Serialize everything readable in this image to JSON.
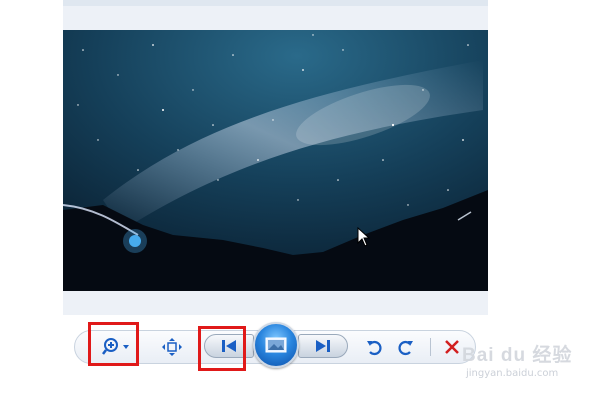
{
  "image_viewer": {
    "photo": {
      "subject": "night-sky-milky-way"
    },
    "toolbar": {
      "buttons": {
        "zoom": "zoom-icon",
        "fit": "fit-window-icon",
        "previous": "previous-icon",
        "slideshow": "slideshow-icon",
        "next": "next-icon",
        "rotate_ccw": "rotate-counterclockwise-icon",
        "rotate_cw": "rotate-clockwise-icon",
        "delete": "delete-icon"
      },
      "accent_color": "#1a5fc4",
      "delete_color": "#d21f1f"
    }
  },
  "annotations": {
    "highlight_color": "#e01919"
  },
  "watermark": {
    "main": "Bai du 经验",
    "sub": "jingyan.baidu.com"
  }
}
